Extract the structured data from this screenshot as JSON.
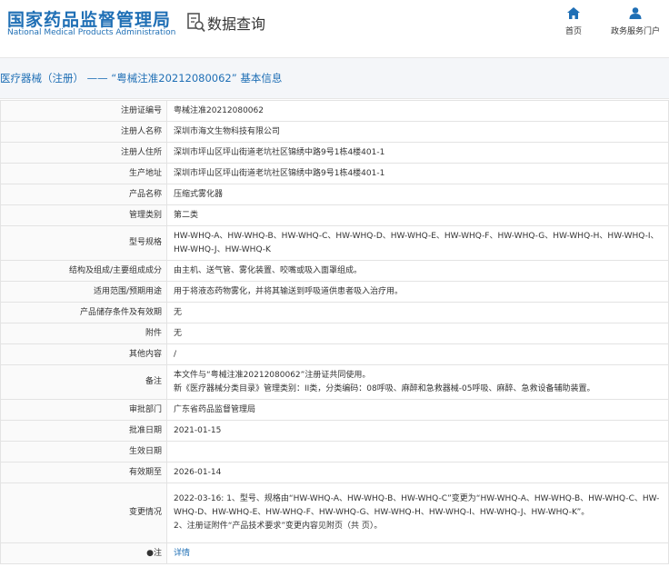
{
  "header": {
    "logo_cn": "国家药品监督管理局",
    "logo_en": "National Medical Products Administration",
    "section_title": "数据查询",
    "nav": [
      {
        "label": "首页",
        "icon": "home-icon"
      },
      {
        "label": "政务服务门户",
        "icon": "user-icon"
      }
    ]
  },
  "page": {
    "title": "医疗器械（注册） —— “粤械注准20212080062” 基本信息"
  },
  "colors": {
    "brand": "#1f6fb5",
    "label_bg": "#fafafa",
    "title_bg": "#f4f6f9",
    "border": "#e3e3e3"
  },
  "rows": [
    {
      "label": "注册证编号",
      "value": "粤械注准20212080062"
    },
    {
      "label": "注册人名称",
      "value": "深圳市海文生物科技有限公司"
    },
    {
      "label": "注册人住所",
      "value": "深圳市坪山区坪山街道老坑社区锦绣中路9号1栋4楼401-1"
    },
    {
      "label": "生产地址",
      "value": "深圳市坪山区坪山街道老坑社区锦绣中路9号1栋4楼401-1"
    },
    {
      "label": "产品名称",
      "value": "压缩式雾化器"
    },
    {
      "label": "管理类别",
      "value": "第二类"
    },
    {
      "label": "型号规格",
      "value": "HW-WHQ-A、HW-WHQ-B、HW-WHQ-C、HW-WHQ-D、HW-WHQ-E、HW-WHQ-F、HW-WHQ-G、HW-WHQ-H、HW-WHQ-I、HW-WHQ-J、HW-WHQ-K"
    },
    {
      "label": "结构及组成/主要组成成分",
      "value": "由主机、送气管、雾化装置、咬嘴或吸入面罩组成。"
    },
    {
      "label": "适用范围/预期用途",
      "value": "用于将液态药物雾化，并将其输送到呼吸道供患者吸入治疗用。"
    },
    {
      "label": "产品储存条件及有效期",
      "value": "无"
    },
    {
      "label": "附件",
      "value": "无"
    },
    {
      "label": "其他内容",
      "value": "/"
    },
    {
      "label": "备注",
      "line1": "本文件与“粤械注准20212080062”注册证共同使用。",
      "line2": "新《医疗器械分类目录》管理类别：II类，分类编码：08呼吸、麻醉和急救器械-05呼吸、麻醉、急救设备辅助装置。"
    },
    {
      "label": "审批部门",
      "value": "广东省药品监督管理局"
    },
    {
      "label": "批准日期",
      "value": "2021-01-15"
    },
    {
      "label": "生效日期",
      "value": ""
    },
    {
      "label": "有效期至",
      "value": "2026-01-14"
    },
    {
      "label": "变更情况",
      "line1": "2022-03-16: 1、型号、规格由“HW-WHQ-A、HW-WHQ-B、HW-WHQ-C”变更为“HW-WHQ-A、HW-WHQ-B、HW-WHQ-C、HW-WHQ-D、HW-WHQ-E、HW-WHQ-F、HW-WHQ-G、HW-WHQ-H、HW-WHQ-I、HW-WHQ-J、HW-WHQ-K”。",
      "line2": "2、注册证附件“产品技术要求”变更内容见附页（共 页）。"
    },
    {
      "label": "●注",
      "value": "详情"
    }
  ]
}
